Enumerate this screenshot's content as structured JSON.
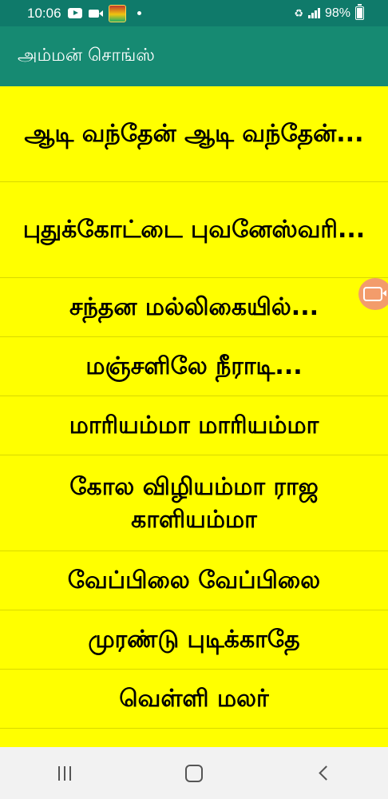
{
  "status_bar": {
    "time": "10:06",
    "battery": "98%",
    "icons": [
      "youtube-icon",
      "video-camera-icon",
      "app-thumbnail-icon",
      "notification-dot-icon",
      "battery-saver-icon",
      "signal-icon",
      "battery-icon"
    ]
  },
  "app_bar": {
    "title": "அம்மன் சொங்ஸ்"
  },
  "songs": [
    {
      "label": "ஆடி வந்தேன் ஆடி வந்தேன்..."
    },
    {
      "label": "புதுக்கோட்டை புவனேஸ்வரி..."
    },
    {
      "label": "சந்தன மல்லிகையில்..."
    },
    {
      "label": "மஞ்சளிலே நீராடி..."
    },
    {
      "label": "மாரியம்மா மாரியம்மா"
    },
    {
      "label": "கோல விழியம்மா ராஜ காளியம்மா"
    },
    {
      "label": "வேப்பிலை வேப்பிலை"
    },
    {
      "label": "முரண்டு புடிக்காதே"
    },
    {
      "label": "வெள்ளி மலர்"
    }
  ],
  "colors": {
    "status_bar": "#0f7a6a",
    "app_bar": "#168a72",
    "list_background": "#ffff00",
    "floating_button": "#f39c6b",
    "nav_bar": "#f2f2f2"
  },
  "nav_bar": {
    "buttons": [
      "recents-icon",
      "home-icon",
      "back-icon"
    ]
  }
}
